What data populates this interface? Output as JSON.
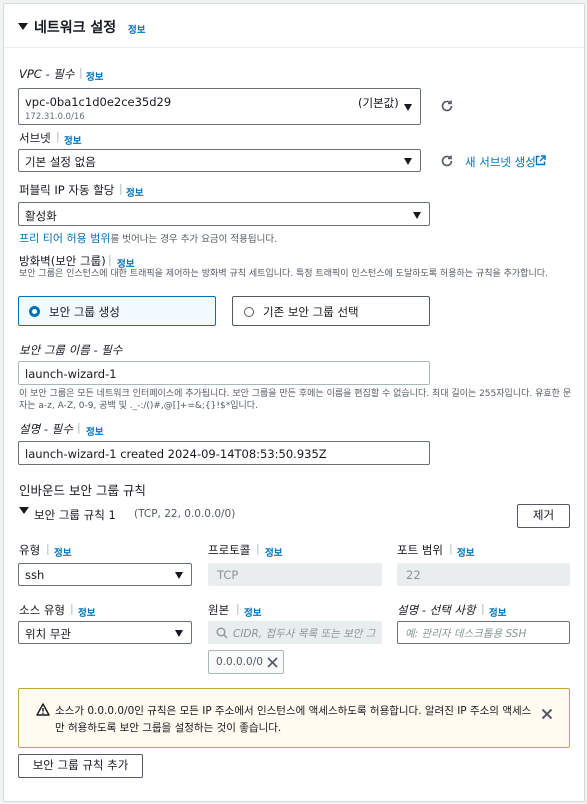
{
  "section": {
    "title": "네트워크 설정",
    "info": "정보"
  },
  "vpc": {
    "label": "VPC - 필수",
    "info": "정보",
    "value": "vpc-0ba1c1d0e2ce35d29",
    "default_tag": "(기본값)",
    "cidr": "172.31.0.0/16"
  },
  "subnet": {
    "label": "서브넷",
    "info": "정보",
    "value": "기본 설정 없음",
    "new_link": "새 서브넷 생성"
  },
  "public_ip": {
    "label": "퍼블릭 IP 자동 할당",
    "info": "정보",
    "value": "활성화",
    "free_tier_link": "프리 티어 허용 범위",
    "free_tier_note": "를 벗어나는 경우 추가 요금이 적용됩니다."
  },
  "firewall": {
    "label": "방화벽(보안 그룹)",
    "info": "정보",
    "description": "보안 그룹은 인스턴스에 대한 트래픽을 제어하는 방화벽 규칙 세트입니다. 특정 트래픽이 인스턴스에 도달하도록 허용하는 규칙을 추가합니다.",
    "option_create": "보안 그룹 생성",
    "option_existing": "기존 보안 그룹 선택",
    "selected": "create"
  },
  "sg_name": {
    "label": "보안 그룹 이름 - 필수",
    "value": "launch-wizard-1",
    "help": "이 보안 그룹은 모든 네트워크 인터페이스에 추가됩니다. 보안 그룹을 만든 후에는 이름을 편집할 수 없습니다. 최대 길이는 255자입니다. 유효한 문자는 a-z, A-Z, 0-9, 공백 및 ._-:/()#,@[]+=&;{}!$*입니다."
  },
  "description": {
    "label": "설명 - 필수",
    "info": "정보",
    "value": "launch-wizard-1 created 2024-09-14T08:53:50.935Z"
  },
  "inbound": {
    "title": "인바운드 보안 그룹 규칙",
    "rule_title": "보안 그룹 규칙 1",
    "rule_summary": "(TCP, 22, 0.0.0.0/0)",
    "remove_button": "제거",
    "type_label": "유형",
    "type_info": "정보",
    "type_value": "ssh",
    "protocol_label": "프로토콜",
    "protocol_info": "정보",
    "protocol_value": "TCP",
    "port_label": "포트 범위",
    "port_info": "정보",
    "port_value": "22",
    "source_type_label": "소스 유형",
    "source_type_info": "정보",
    "source_type_value": "위치 무관",
    "source_label": "원본",
    "source_info": "정보",
    "source_placeholder": "CIDR, 접두사 목록 또는 보안 그",
    "source_token": "0.0.0.0/0",
    "desc_label": "설명 - 선택 사항",
    "desc_info": "정보",
    "desc_placeholder": "예: 관리자 데스크톱용 SSH"
  },
  "warning": {
    "text": "소스가 0.0.0.0/0인 규칙은 모든 IP 주소에서 인스턴스에 액세스하도록 허용합니다. 알려진 IP 주소의 액세스만 허용하도록 보안 그룹을 설정하는 것이 좋습니다."
  },
  "add_rule_button": "보안 그룹 규칙 추가",
  "colors": {
    "link": "#0073bb",
    "warning_bg": "#fffbf0",
    "warning_border": "#c7a33c",
    "selected_bg": "#f1faff"
  }
}
